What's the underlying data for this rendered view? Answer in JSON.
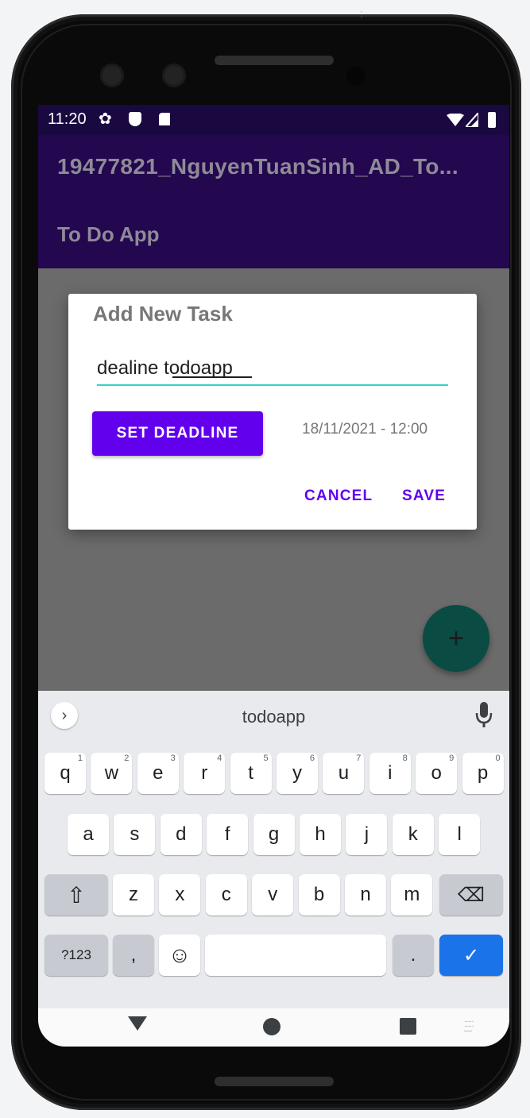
{
  "status_bar": {
    "time": "11:20",
    "icons": [
      "gear-icon",
      "shield-icon",
      "sd-card-icon",
      "wifi-icon",
      "signal-icon",
      "battery-icon"
    ]
  },
  "app_bar": {
    "title": "19477821_NguyenTuanSinh_AD_To...",
    "subtitle": "To Do App"
  },
  "dialog": {
    "title": "Add New Task",
    "input_value": "dealine todoapp",
    "set_deadline_label": "SET DEADLINE",
    "deadline_value": "18/11/2021 - 12:00",
    "cancel_label": "CANCEL",
    "save_label": "SAVE"
  },
  "fab": {
    "icon": "plus-icon",
    "label": "+"
  },
  "keyboard": {
    "suggestion": "todoapp",
    "row1": [
      {
        "k": "q",
        "h": "1"
      },
      {
        "k": "w",
        "h": "2"
      },
      {
        "k": "e",
        "h": "3"
      },
      {
        "k": "r",
        "h": "4"
      },
      {
        "k": "t",
        "h": "5"
      },
      {
        "k": "y",
        "h": "6"
      },
      {
        "k": "u",
        "h": "7"
      },
      {
        "k": "i",
        "h": "8"
      },
      {
        "k": "o",
        "h": "9"
      },
      {
        "k": "p",
        "h": "0"
      }
    ],
    "row2": [
      "a",
      "s",
      "d",
      "f",
      "g",
      "h",
      "j",
      "k",
      "l"
    ],
    "row3": [
      "z",
      "x",
      "c",
      "v",
      "b",
      "n",
      "m"
    ],
    "symbols_label": "?123",
    "comma_label": ",",
    "period_label": ".",
    "enter_label": "✓",
    "shift_icon": "⇧",
    "emoji_icon": "☺",
    "backspace_icon": "⌫"
  },
  "colors": {
    "primary": "#6200ee",
    "app_bar": "#23074f",
    "accent_underline": "#2fd4c8",
    "fab": "#0a4b43"
  }
}
